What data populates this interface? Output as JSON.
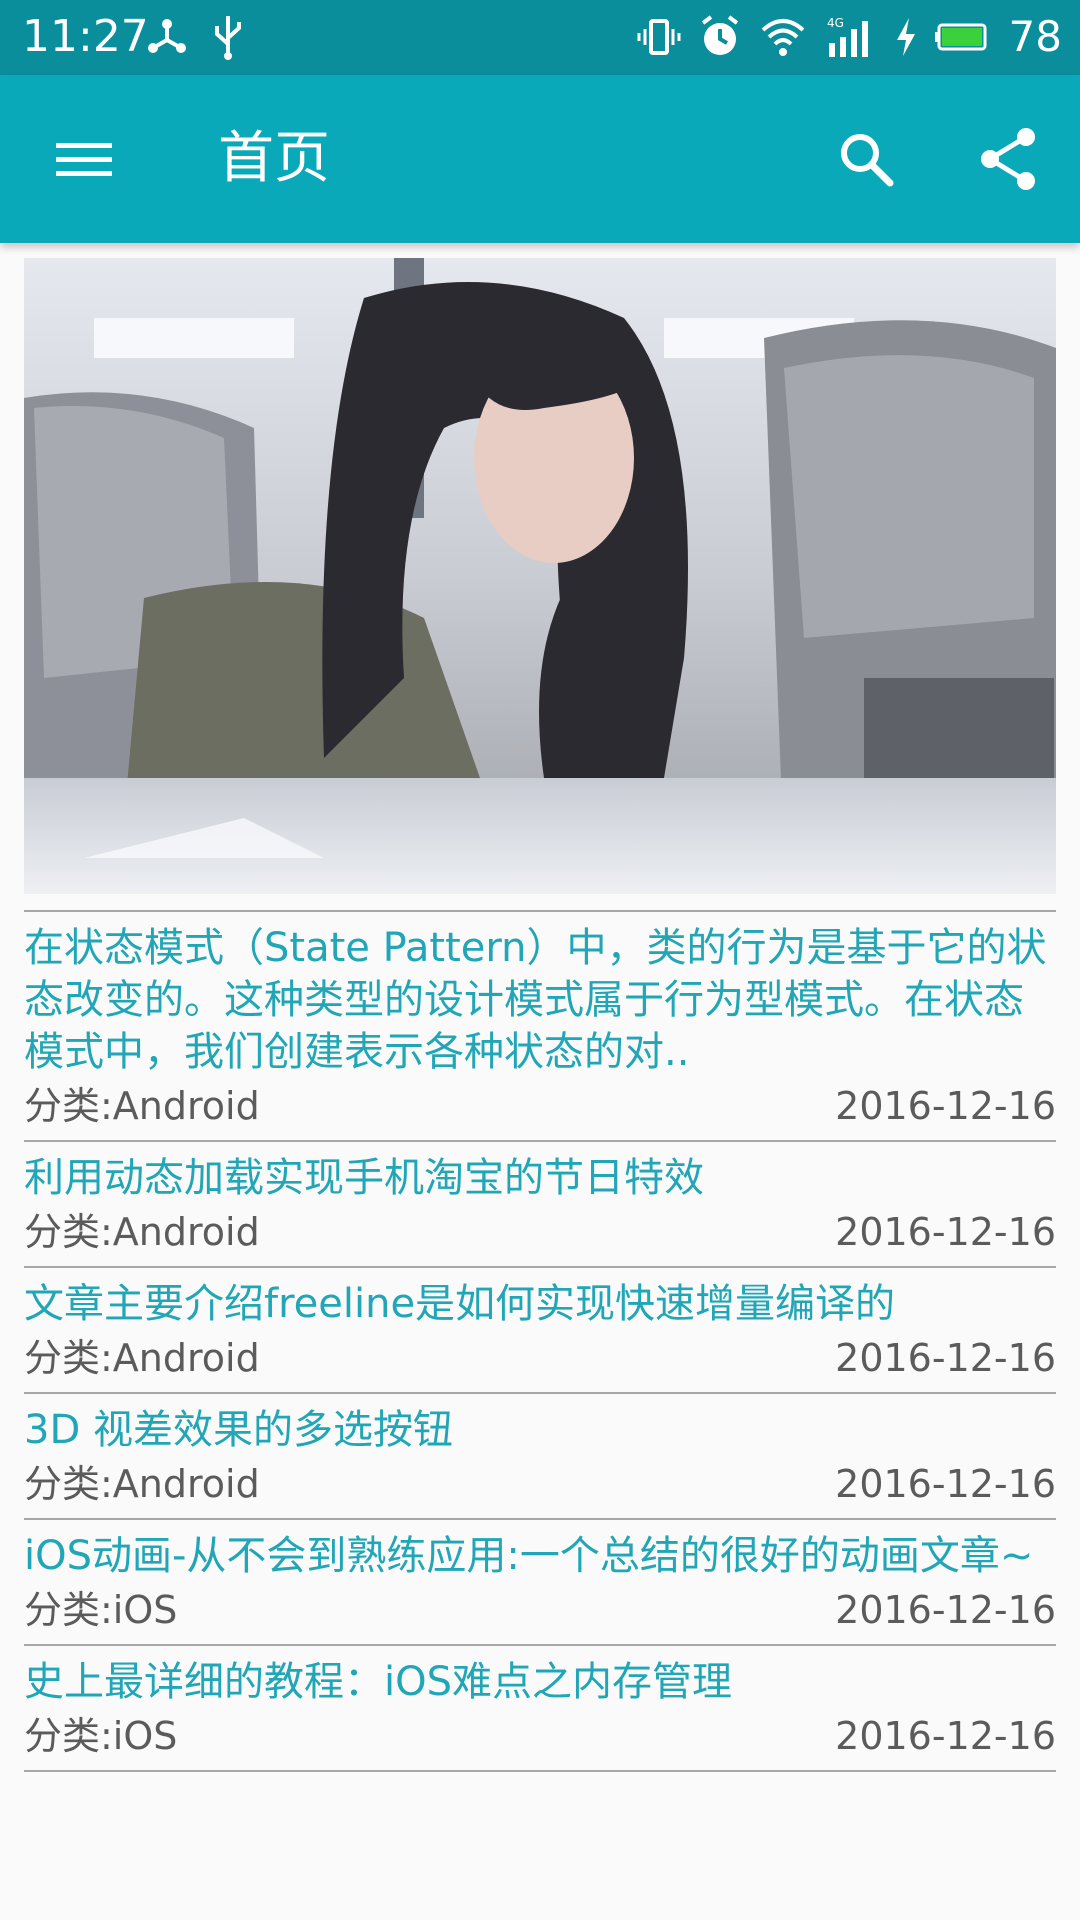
{
  "status_bar": {
    "time": "11:27",
    "battery": "78",
    "battery_color": "#3ad13a"
  },
  "app_bar": {
    "title": "首页",
    "menu_icon": "menu-icon",
    "search_icon": "search-icon",
    "share_icon": "share-icon",
    "color": "#09a9b9"
  },
  "articles": [
    {
      "title": "在状态模式（State Pattern）中，类的行为是基于它的状态改变的。这种类型的设计模式属于行为型模式。在状态模式中，我们创建表示各种状态的对..",
      "category": "分类:Android",
      "date": "2016-12-16"
    },
    {
      "title": "利用动态加载实现手机淘宝的节日特效",
      "category": "分类:Android",
      "date": "2016-12-16"
    },
    {
      "title": "文章主要介绍freeline是如何实现快速增量编译的",
      "category": "分类:Android",
      "date": "2016-12-16"
    },
    {
      "title": "3D 视差效果的多选按钮",
      "category": "分类:Android",
      "date": "2016-12-16"
    },
    {
      "title": "iOS动画-从不会到熟练应用:一个总结的很好的动画文章~",
      "category": "分类:iOS",
      "date": "2016-12-16"
    },
    {
      "title": "史上最详细的教程：iOS难点之内存管理",
      "category": "分类:iOS",
      "date": "2016-12-16"
    }
  ]
}
